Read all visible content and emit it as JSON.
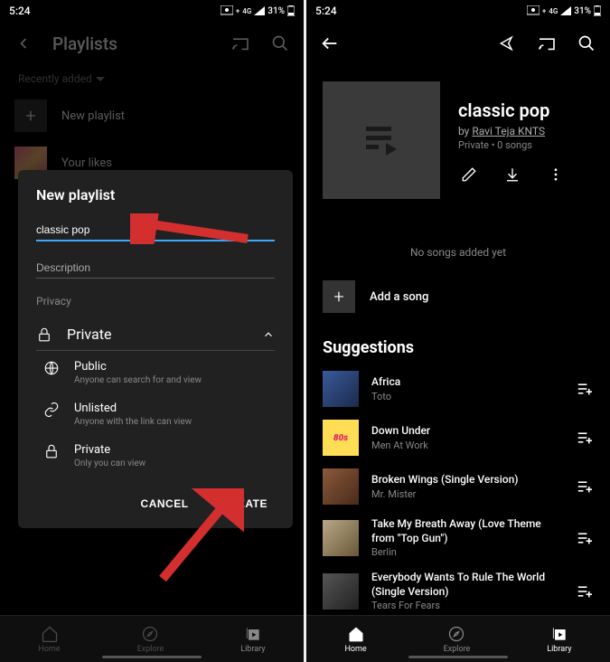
{
  "status": {
    "time": "5:24",
    "battery": "31%",
    "network": "4G"
  },
  "left": {
    "header_title": "Playlists",
    "sort": "Recently added",
    "new_playlist_label": "New playlist",
    "your_likes_label": "Your likes"
  },
  "modal": {
    "title": "New playlist",
    "name_value": "classic pop",
    "desc_placeholder": "Description",
    "privacy_label": "Privacy",
    "selected": "Private",
    "options": [
      {
        "title": "Public",
        "sub": "Anyone can search for and view"
      },
      {
        "title": "Unlisted",
        "sub": "Anyone with the link can view"
      },
      {
        "title": "Private",
        "sub": "Only you can view"
      }
    ],
    "cancel": "CANCEL",
    "create": "CREATE"
  },
  "right": {
    "playlist_name": "classic pop",
    "author_prefix": "by ",
    "author": "Ravi Teja KNTS",
    "meta": "Private • 0 songs",
    "no_songs": "No songs added yet",
    "add_song": "Add a song",
    "suggestions": "Suggestions",
    "songs": [
      {
        "title": "Africa",
        "artist": "Toto"
      },
      {
        "title": "Down Under",
        "artist": "Men At Work"
      },
      {
        "title": "Broken Wings (Single Version)",
        "artist": "Mr. Mister"
      },
      {
        "title": "Take My Breath Away (Love Theme from \"Top Gun\")",
        "artist": "Berlin"
      },
      {
        "title": "Everybody Wants To Rule The World (Single Version)",
        "artist": "Tears For Fears"
      }
    ]
  },
  "nav": {
    "home": "Home",
    "explore": "Explore",
    "library": "Library"
  }
}
